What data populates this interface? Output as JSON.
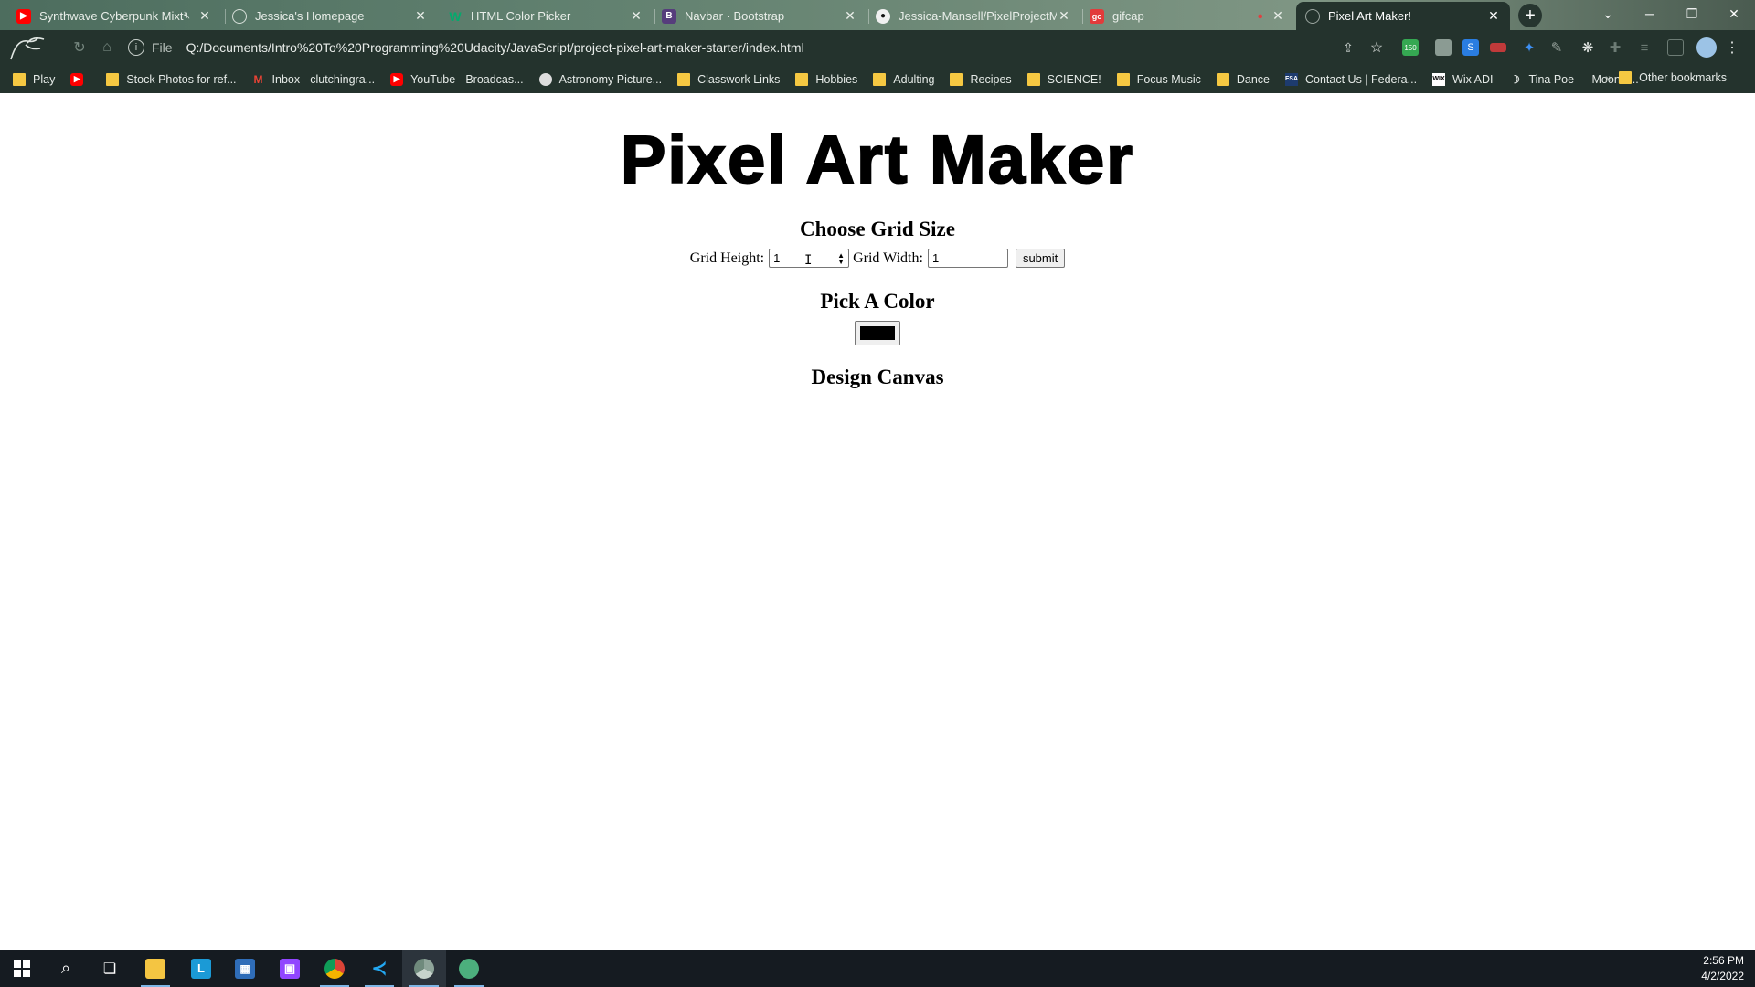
{
  "browser": {
    "tabs": [
      {
        "title": "Synthwave Cyberpunk Mixt",
        "icon": "youtube-icon",
        "muted": true
      },
      {
        "title": "Jessica's Homepage",
        "icon": "globe-icon"
      },
      {
        "title": "HTML Color Picker",
        "icon": "w3schools-icon"
      },
      {
        "title": "Navbar · Bootstrap",
        "icon": "bootstrap-icon"
      },
      {
        "title": "Jessica-Mansell/PixelProjectMa",
        "icon": "github-icon"
      },
      {
        "title": "gifcap",
        "icon": "gifcap-icon"
      },
      {
        "title": "Pixel Art Maker!",
        "icon": "globe-icon",
        "active": true
      }
    ],
    "new_tab": "+",
    "window_controls": {
      "tabsearch": "⌄",
      "minimize": "─",
      "restore": "❐",
      "close": "✕"
    },
    "omnibox": {
      "scheme_label": "File",
      "url": "Q:/Documents/Intro%20To%20Programming%20Udacity/JavaScript/project-pixel-art-maker-starter/index.html"
    },
    "extension_badge": "150",
    "bookmarks": [
      {
        "label": "Play",
        "icon": "folder-icon"
      },
      {
        "label": "",
        "icon": "youtube-icon"
      },
      {
        "label": "Stock Photos for ref...",
        "icon": "folder-icon"
      },
      {
        "label": "Inbox - clutchingra...",
        "icon": "gmail-icon"
      },
      {
        "label": "YouTube - Broadcas...",
        "icon": "youtube-icon"
      },
      {
        "label": "Astronomy Picture...",
        "icon": "apod-icon"
      },
      {
        "label": "Classwork Links",
        "icon": "folder-icon"
      },
      {
        "label": "Hobbies",
        "icon": "folder-icon"
      },
      {
        "label": "Adulting",
        "icon": "folder-icon"
      },
      {
        "label": "Recipes",
        "icon": "folder-icon"
      },
      {
        "label": "SCIENCE!",
        "icon": "folder-icon"
      },
      {
        "label": "Focus Music",
        "icon": "folder-icon"
      },
      {
        "label": "Dance",
        "icon": "folder-icon"
      },
      {
        "label": "Contact Us | Federa...",
        "icon": "fsa-icon"
      },
      {
        "label": "Wix ADI",
        "icon": "wix-icon"
      },
      {
        "label": "Tina Poe — Moon T...",
        "icon": "moon-icon"
      }
    ],
    "bookmarks_more": "»",
    "other_bookmarks": "Other bookmarks"
  },
  "page": {
    "logo_text": "Pixel Art Maker",
    "grid_heading": "Choose Grid Size",
    "height_label": "Grid Height:",
    "height_value": "1",
    "width_label": "Grid Width:",
    "width_value": "1",
    "submit_label": "submit",
    "color_heading": "Pick A Color",
    "color_value": "#000000",
    "canvas_heading": "Design Canvas"
  },
  "taskbar": {
    "apps": [
      "windows-start-icon",
      "search-icon",
      "task-view-icon",
      "file-explorer-icon",
      "l-app-icon",
      "calculator-icon",
      "twitch-icon",
      "chrome-icon",
      "vscode-icon",
      "chrome-icon",
      "globe-app-icon"
    ],
    "time": "2:56 PM",
    "date": "4/2/2022"
  }
}
